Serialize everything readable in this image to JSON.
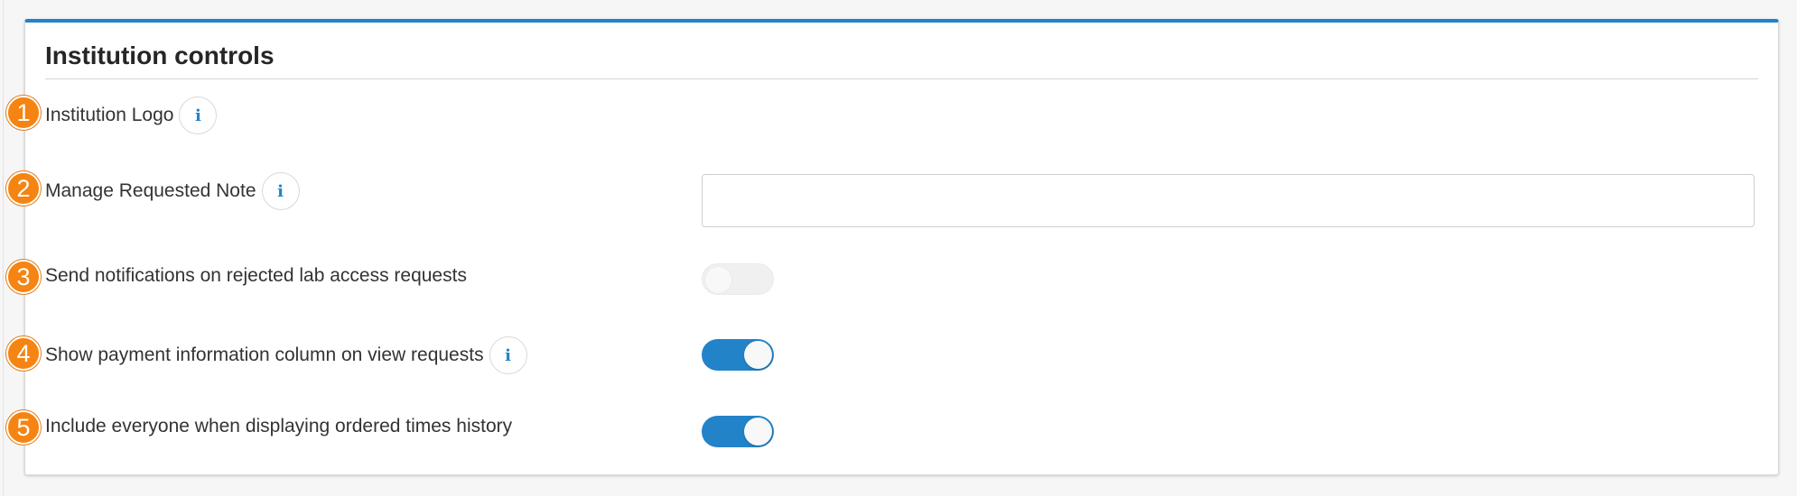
{
  "panel": {
    "title": "Institution controls"
  },
  "rows": [
    {
      "number": "1",
      "label": "Institution Logo",
      "has_info": true
    },
    {
      "number": "2",
      "label": "Manage Requested Note",
      "has_info": true,
      "input_value": ""
    },
    {
      "number": "3",
      "label": "Send notifications on rejected lab access requests",
      "has_info": false,
      "toggle_state": "off"
    },
    {
      "number": "4",
      "label": "Show payment information column on view requests",
      "has_info": true,
      "toggle_state": "on"
    },
    {
      "number": "5",
      "label": "Include everyone when displaying ordered times history",
      "has_info": false,
      "toggle_state": "on"
    }
  ],
  "icons": {
    "info": "info-icon",
    "info_glyph": "i"
  },
  "colors": {
    "accent": "#2383c9",
    "badge": "#f58412",
    "toggle_off": "#eeeeee",
    "panel_bg": "#ffffff"
  }
}
